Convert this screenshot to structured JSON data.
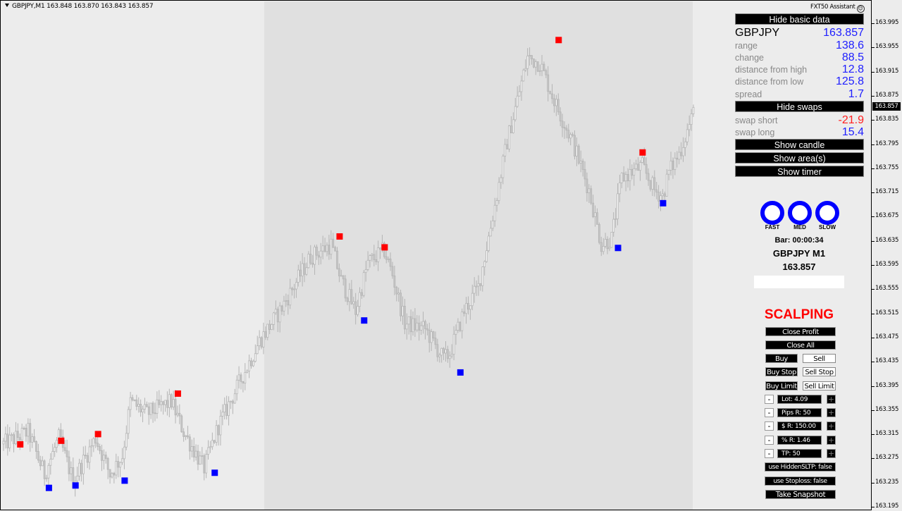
{
  "chart": {
    "symbol_header": "GBPJPY,M1  163.848 163.870 163.843 163.857",
    "symbol": "GBPJPY",
    "timeframe": "M1",
    "ohlc": {
      "open": "163.848",
      "high": "163.870",
      "low": "163.843",
      "close": "163.857"
    },
    "current_price": "163.857",
    "shaded_zone_note": "background zone shaded from bar 128 to last bar"
  },
  "chart_data": {
    "type": "candlestick",
    "title": "GBPJPY,M1",
    "ylim": [
      163.195,
      164.0
    ],
    "y_ticks": [
      "163.995",
      "163.955",
      "163.915",
      "163.875",
      "163.835",
      "163.795",
      "163.755",
      "163.715",
      "163.675",
      "163.635",
      "163.595",
      "163.555",
      "163.515",
      "163.475",
      "163.435",
      "163.395",
      "163.355",
      "163.315",
      "163.275",
      "163.235",
      "163.195"
    ],
    "bar_count": 338,
    "price_path_waypoints": [
      [
        0,
        163.3
      ],
      [
        12,
        163.32
      ],
      [
        20,
        163.25
      ],
      [
        27,
        163.31
      ],
      [
        34,
        163.24
      ],
      [
        45,
        163.31
      ],
      [
        52,
        163.25
      ],
      [
        58,
        163.28
      ],
      [
        62,
        163.37
      ],
      [
        70,
        163.35
      ],
      [
        82,
        163.37
      ],
      [
        88,
        163.32
      ],
      [
        98,
        163.26
      ],
      [
        105,
        163.33
      ],
      [
        115,
        163.4
      ],
      [
        125,
        163.47
      ],
      [
        135,
        163.52
      ],
      [
        150,
        163.61
      ],
      [
        160,
        163.63
      ],
      [
        165,
        163.57
      ],
      [
        172,
        163.52
      ],
      [
        178,
        163.6
      ],
      [
        186,
        163.62
      ],
      [
        190,
        163.58
      ],
      [
        196,
        163.5
      ],
      [
        206,
        163.49
      ],
      [
        215,
        163.44
      ],
      [
        218,
        163.45
      ],
      [
        225,
        163.52
      ],
      [
        232,
        163.56
      ],
      [
        238,
        163.66
      ],
      [
        246,
        163.8
      ],
      [
        256,
        163.94
      ],
      [
        262,
        163.93
      ],
      [
        270,
        163.86
      ],
      [
        278,
        163.8
      ],
      [
        286,
        163.72
      ],
      [
        292,
        163.63
      ],
      [
        297,
        163.64
      ],
      [
        302,
        163.74
      ],
      [
        312,
        163.76
      ],
      [
        318,
        163.72
      ],
      [
        322,
        163.71
      ],
      [
        325,
        163.75
      ],
      [
        330,
        163.78
      ],
      [
        338,
        163.857
      ]
    ],
    "markers": {
      "sell_signals_red": [
        [
          8,
          163.3
        ],
        [
          28,
          163.306
        ],
        [
          46,
          163.317
        ],
        [
          85,
          163.384
        ],
        [
          164,
          163.644
        ],
        [
          186,
          163.626
        ],
        [
          271,
          163.969
        ],
        [
          312,
          163.783
        ]
      ],
      "buy_signals_blue": [
        [
          22,
          163.228
        ],
        [
          35,
          163.232
        ],
        [
          59,
          163.24
        ],
        [
          103,
          163.253
        ],
        [
          176,
          163.505
        ],
        [
          223,
          163.419
        ],
        [
          300,
          163.625
        ],
        [
          322,
          163.699
        ]
      ]
    },
    "colors": {
      "candle": "#b4b4b4",
      "sell_marker": "#ff0000",
      "buy_marker": "#0000ff"
    }
  },
  "panel": {
    "assistant_title": "FXT50 Assistant",
    "hide_basic_label": "Hide basic data",
    "symbol": "GBPJPY",
    "symbol_price": "163.857",
    "stats": [
      {
        "label": "range",
        "value": "138.6"
      },
      {
        "label": "change",
        "value": "88.5"
      },
      {
        "label": "distance from high",
        "value": "12.8"
      },
      {
        "label": "distance from low",
        "value": "125.8"
      },
      {
        "label": "spread",
        "value": "1.7"
      }
    ],
    "hide_swaps_label": "Hide swaps",
    "swaps": [
      {
        "label": "swap short",
        "value": "-21.9",
        "color": "#ff2020"
      },
      {
        "label": "swap long",
        "value": "15.4",
        "color": "#2020ff"
      }
    ],
    "show_candle_label": "Show candle",
    "show_areas_label": "Show area(s)",
    "show_timer_label": "Show timer",
    "speed_indicators": [
      "FAST",
      "MED",
      "SLOW"
    ],
    "bar_timer": "Bar: 00:00:34",
    "symbol_tf": "GBPJPY M1",
    "price_big": "163.857"
  },
  "scalping": {
    "title": "SCALPING",
    "close_profit": "Close Profit",
    "close_all": "Close All",
    "buy": "Buy",
    "sell": "Sell",
    "buy_stop": "Buy Stop",
    "sell_stop": "Sell Stop",
    "buy_limit": "Buy Limit",
    "sell_limit": "Sell Limit",
    "fields": [
      {
        "label": "Lot: 4.09"
      },
      {
        "label": "Pips R: 50"
      },
      {
        "label": "$ R: 150.00"
      },
      {
        "label": "% R: 1.46"
      },
      {
        "label": "TP: 50"
      }
    ],
    "minus_symbol": "-",
    "plus_symbol": "+",
    "hidden_sltp": "use HiddenSLTP: false",
    "use_stoploss": "use Stoploss: false",
    "take_snapshot": "Take Snapshot"
  }
}
